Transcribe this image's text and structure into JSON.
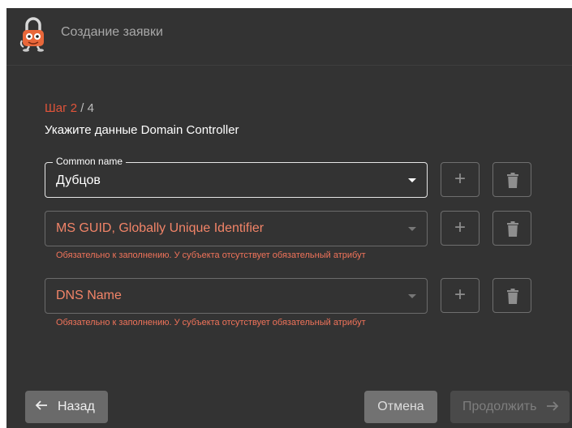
{
  "header": {
    "title": "Создание заявки",
    "logo_icon": "padlock-mascot-icon"
  },
  "step": {
    "current": "Шаг 2",
    "total": " / 4",
    "current_color": "#e2543a"
  },
  "subtitle": "Укажите данные Domain Controller",
  "fields": [
    {
      "legend": "Common name",
      "value": "Дубцов",
      "error": ""
    },
    {
      "legend": "",
      "value": "MS GUID, Globally Unique Identifier",
      "error": "Обязательно к заполнению. У субъекта отсутствует обязательный атрибут"
    },
    {
      "legend": "",
      "value": "DNS Name",
      "error": "Обязательно к заполнению. У субъекта отсутствует обязательный атрибут"
    }
  ],
  "row_buttons": {
    "add": "+",
    "add_icon": "plus-icon",
    "delete_icon": "trash-icon"
  },
  "footer": {
    "back_label": "Назад",
    "cancel_label": "Отмена",
    "next_label": "Продолжить"
  },
  "colors": {
    "dialog_bg": "#333333",
    "error_text": "#f0735a",
    "error_value": "#f28468"
  }
}
